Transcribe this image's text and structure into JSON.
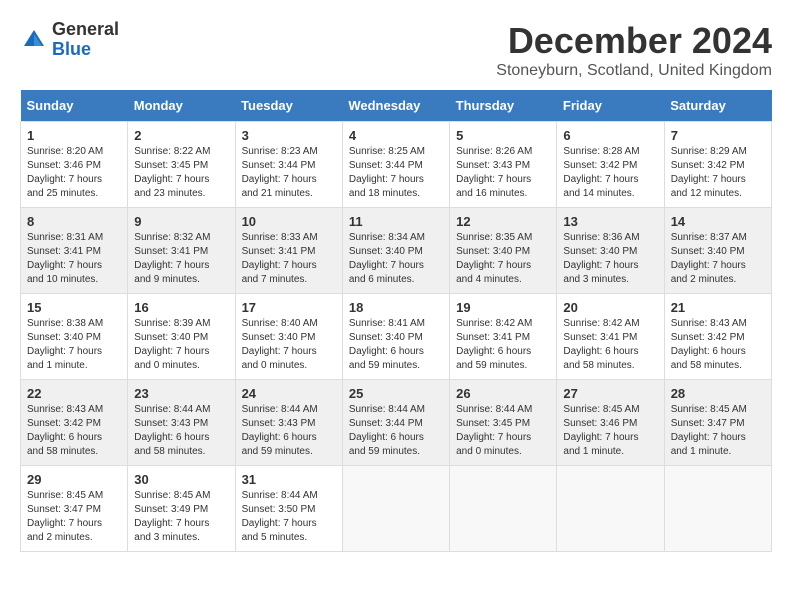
{
  "logo": {
    "general": "General",
    "blue": "Blue"
  },
  "title": "December 2024",
  "location": "Stoneyburn, Scotland, United Kingdom",
  "weekdays": [
    "Sunday",
    "Monday",
    "Tuesday",
    "Wednesday",
    "Thursday",
    "Friday",
    "Saturday"
  ],
  "weeks": [
    [
      {
        "day": 1,
        "rise": "8:20 AM",
        "set": "3:46 PM",
        "daylight": "7 hours and 25 minutes."
      },
      {
        "day": 2,
        "rise": "8:22 AM",
        "set": "3:45 PM",
        "daylight": "7 hours and 23 minutes."
      },
      {
        "day": 3,
        "rise": "8:23 AM",
        "set": "3:44 PM",
        "daylight": "7 hours and 21 minutes."
      },
      {
        "day": 4,
        "rise": "8:25 AM",
        "set": "3:44 PM",
        "daylight": "7 hours and 18 minutes."
      },
      {
        "day": 5,
        "rise": "8:26 AM",
        "set": "3:43 PM",
        "daylight": "7 hours and 16 minutes."
      },
      {
        "day": 6,
        "rise": "8:28 AM",
        "set": "3:42 PM",
        "daylight": "7 hours and 14 minutes."
      },
      {
        "day": 7,
        "rise": "8:29 AM",
        "set": "3:42 PM",
        "daylight": "7 hours and 12 minutes."
      }
    ],
    [
      {
        "day": 8,
        "rise": "8:31 AM",
        "set": "3:41 PM",
        "daylight": "7 hours and 10 minutes."
      },
      {
        "day": 9,
        "rise": "8:32 AM",
        "set": "3:41 PM",
        "daylight": "7 hours and 9 minutes."
      },
      {
        "day": 10,
        "rise": "8:33 AM",
        "set": "3:41 PM",
        "daylight": "7 hours and 7 minutes."
      },
      {
        "day": 11,
        "rise": "8:34 AM",
        "set": "3:40 PM",
        "daylight": "7 hours and 6 minutes."
      },
      {
        "day": 12,
        "rise": "8:35 AM",
        "set": "3:40 PM",
        "daylight": "7 hours and 4 minutes."
      },
      {
        "day": 13,
        "rise": "8:36 AM",
        "set": "3:40 PM",
        "daylight": "7 hours and 3 minutes."
      },
      {
        "day": 14,
        "rise": "8:37 AM",
        "set": "3:40 PM",
        "daylight": "7 hours and 2 minutes."
      }
    ],
    [
      {
        "day": 15,
        "rise": "8:38 AM",
        "set": "3:40 PM",
        "daylight": "7 hours and 1 minute."
      },
      {
        "day": 16,
        "rise": "8:39 AM",
        "set": "3:40 PM",
        "daylight": "7 hours and 0 minutes."
      },
      {
        "day": 17,
        "rise": "8:40 AM",
        "set": "3:40 PM",
        "daylight": "7 hours and 0 minutes."
      },
      {
        "day": 18,
        "rise": "8:41 AM",
        "set": "3:40 PM",
        "daylight": "6 hours and 59 minutes."
      },
      {
        "day": 19,
        "rise": "8:42 AM",
        "set": "3:41 PM",
        "daylight": "6 hours and 59 minutes."
      },
      {
        "day": 20,
        "rise": "8:42 AM",
        "set": "3:41 PM",
        "daylight": "6 hours and 58 minutes."
      },
      {
        "day": 21,
        "rise": "8:43 AM",
        "set": "3:42 PM",
        "daylight": "6 hours and 58 minutes."
      }
    ],
    [
      {
        "day": 22,
        "rise": "8:43 AM",
        "set": "3:42 PM",
        "daylight": "6 hours and 58 minutes."
      },
      {
        "day": 23,
        "rise": "8:44 AM",
        "set": "3:43 PM",
        "daylight": "6 hours and 58 minutes."
      },
      {
        "day": 24,
        "rise": "8:44 AM",
        "set": "3:43 PM",
        "daylight": "6 hours and 59 minutes."
      },
      {
        "day": 25,
        "rise": "8:44 AM",
        "set": "3:44 PM",
        "daylight": "6 hours and 59 minutes."
      },
      {
        "day": 26,
        "rise": "8:44 AM",
        "set": "3:45 PM",
        "daylight": "7 hours and 0 minutes."
      },
      {
        "day": 27,
        "rise": "8:45 AM",
        "set": "3:46 PM",
        "daylight": "7 hours and 1 minute."
      },
      {
        "day": 28,
        "rise": "8:45 AM",
        "set": "3:47 PM",
        "daylight": "7 hours and 1 minute."
      }
    ],
    [
      {
        "day": 29,
        "rise": "8:45 AM",
        "set": "3:47 PM",
        "daylight": "7 hours and 2 minutes."
      },
      {
        "day": 30,
        "rise": "8:45 AM",
        "set": "3:49 PM",
        "daylight": "7 hours and 3 minutes."
      },
      {
        "day": 31,
        "rise": "8:44 AM",
        "set": "3:50 PM",
        "daylight": "7 hours and 5 minutes."
      },
      null,
      null,
      null,
      null
    ]
  ]
}
